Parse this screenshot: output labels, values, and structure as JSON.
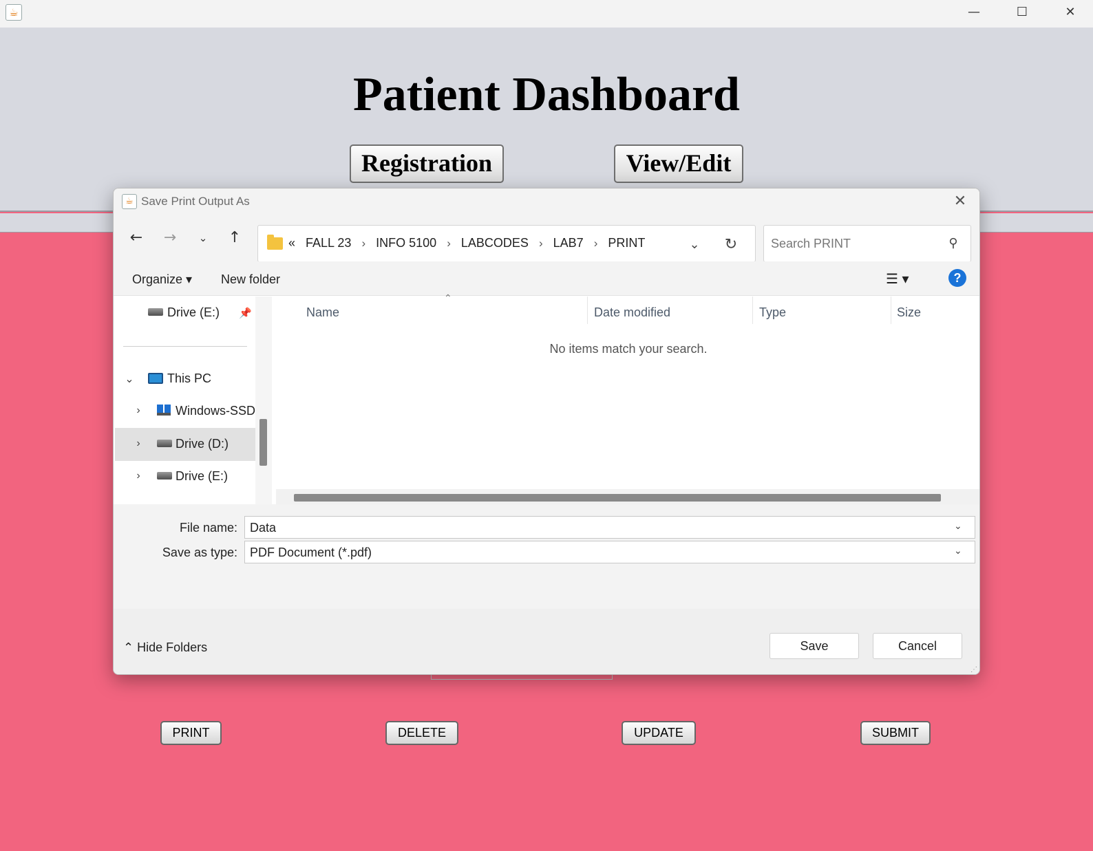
{
  "window": {
    "app_icon": "java-icon",
    "minimize_glyph": "—",
    "maximize_glyph": "☐",
    "close_glyph": "✕"
  },
  "header": {
    "title": "Patient Dashboard",
    "nav_buttons": [
      "Registration",
      "View/Edit"
    ]
  },
  "actions": [
    "PRINT",
    "DELETE",
    "UPDATE",
    "SUBMIT"
  ],
  "dialog": {
    "title": "Save Print Output As",
    "close_glyph": "✕",
    "nav": {
      "back": "←",
      "forward": "→",
      "recent": "⌄",
      "up": "↑"
    },
    "address": {
      "overflow": "«",
      "crumbs": [
        "FALL 23",
        "INFO 5100",
        "LABCODES",
        "LAB7",
        "PRINT"
      ],
      "separator": "›",
      "dropdown": "⌄",
      "refresh": "↻"
    },
    "search": {
      "placeholder": "Search PRINT",
      "icon": "⚲"
    },
    "toolbar": {
      "organize": "Organize ▾",
      "new_folder": "New folder",
      "view": "☰ ▾",
      "help": "?"
    },
    "tree": {
      "pinned_drive": "Drive (E:)",
      "this_pc": "This PC",
      "items": [
        "Windows-SSD",
        "Drive (D:)",
        "Drive (E:)"
      ],
      "expand_glyph": "›",
      "collapse_glyph": "⌄",
      "pin_glyph": "📌"
    },
    "columns": [
      "Name",
      "Date modified",
      "Type",
      "Size"
    ],
    "sort_glyph": "⌃",
    "empty_message": "No items match your search.",
    "form": {
      "file_name_label": "File name:",
      "file_name_value": "Data",
      "type_label": "Save as type:",
      "type_value": "PDF Document (*.pdf)",
      "dropdown": "⌄"
    },
    "footer": {
      "hide_folders": "⌃ Hide Folders",
      "save": "Save",
      "cancel": "Cancel"
    }
  },
  "colors": {
    "background": "#f2647f",
    "header_panel": "#d7d9e0",
    "help_blue": "#1a73d8",
    "folder_yellow": "#f4c33f"
  }
}
